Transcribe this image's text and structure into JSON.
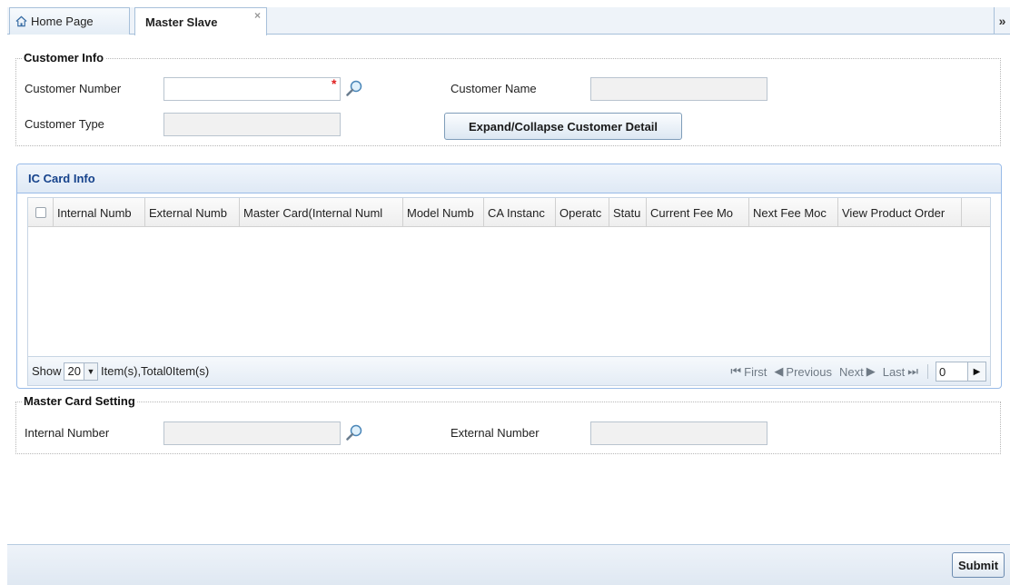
{
  "tabs": {
    "home": "Home Page",
    "master": "Master Slave",
    "close_glyph": "×",
    "collapse_glyph": "»"
  },
  "customer_info": {
    "legend": "Customer Info",
    "customer_number_label": "Customer Number",
    "customer_number_value": "",
    "required_mark": "*",
    "customer_name_label": "Customer Name",
    "customer_name_value": "",
    "customer_type_label": "Customer Type",
    "customer_type_value": "",
    "expand_button": "Expand/Collapse Customer Detail"
  },
  "ic_card_grid": {
    "title": "IC Card Info",
    "columns": [
      "Internal Numb",
      "External Numb",
      "Master Card(Internal Numl",
      "Model Numb",
      "CA Instanc",
      "Operatc",
      "Statu",
      "Current Fee Mo",
      "Next Fee Moc",
      "View Product Order"
    ],
    "rows": [],
    "footer": {
      "show_label": "Show",
      "page_size": "20",
      "items_text": "Item(s),Total0Item(s)",
      "first": "First",
      "previous": "Previous",
      "next": "Next",
      "last": "Last",
      "page_number": "0"
    }
  },
  "master_card_setting": {
    "legend": "Master Card Setting",
    "internal_number_label": "Internal Number",
    "internal_number_value": "",
    "external_number_label": "External Number",
    "external_number_value": ""
  },
  "actions": {
    "submit": "Submit"
  }
}
